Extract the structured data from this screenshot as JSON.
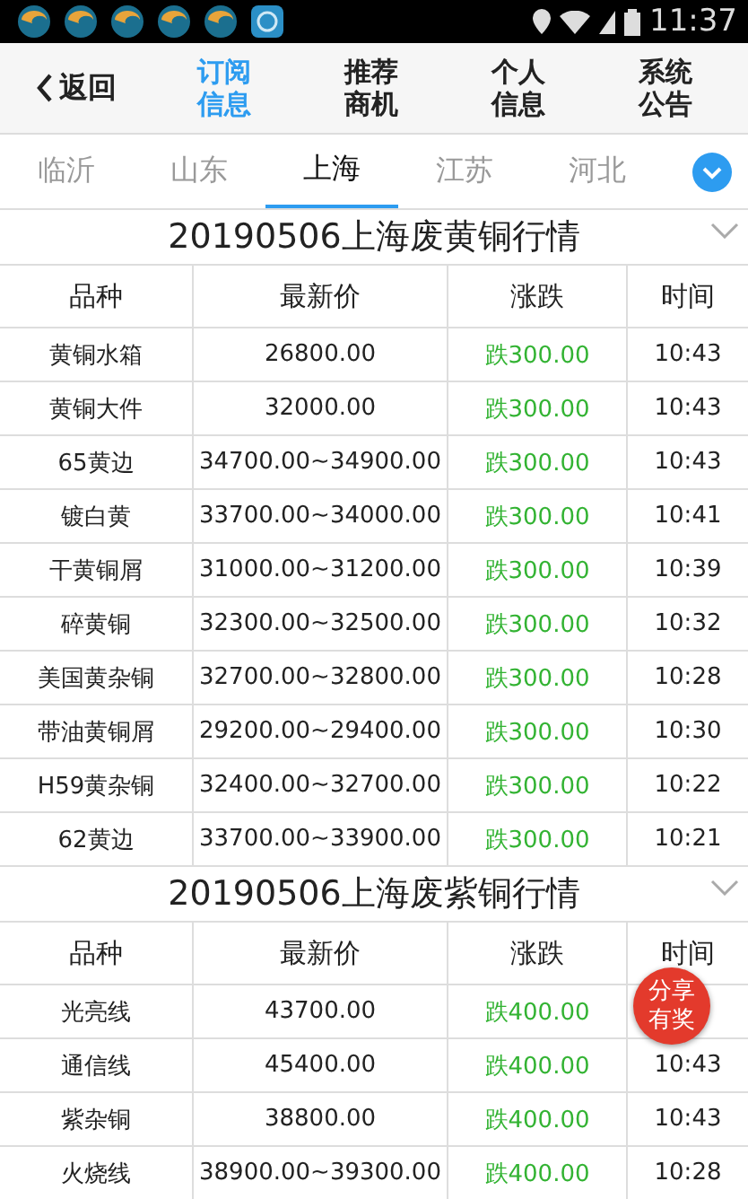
{
  "status_bar": {
    "time": "11:37"
  },
  "nav": {
    "back": "返回",
    "tabs": [
      {
        "label": "订阅信息",
        "selected": true
      },
      {
        "label": "推荐商机",
        "selected": false
      },
      {
        "label": "个人信息",
        "selected": false
      },
      {
        "label": "系统公告",
        "selected": false
      }
    ]
  },
  "regions": [
    {
      "label": "临沂",
      "selected": false
    },
    {
      "label": "山东",
      "selected": false
    },
    {
      "label": "上海",
      "selected": true
    },
    {
      "label": "江苏",
      "selected": false
    },
    {
      "label": "河北",
      "selected": false
    }
  ],
  "sections": [
    {
      "title": "20190506上海废黄铜行情",
      "columns": [
        "品种",
        "最新价",
        "涨跌",
        "时间"
      ],
      "rows": [
        {
          "name": "黄铜水箱",
          "price": "26800.00",
          "change": "跌300.00",
          "falling": true,
          "time": "10:43"
        },
        {
          "name": "黄铜大件",
          "price": "32000.00",
          "change": "跌300.00",
          "falling": true,
          "time": "10:43"
        },
        {
          "name": "65黄边",
          "price": "34700.00~34900.00",
          "change": "跌300.00",
          "falling": true,
          "time": "10:43"
        },
        {
          "name": "镀白黄",
          "price": "33700.00~34000.00",
          "change": "跌300.00",
          "falling": true,
          "time": "10:41"
        },
        {
          "name": "干黄铜屑",
          "price": "31000.00~31200.00",
          "change": "跌300.00",
          "falling": true,
          "time": "10:39"
        },
        {
          "name": "碎黄铜",
          "price": "32300.00~32500.00",
          "change": "跌300.00",
          "falling": true,
          "time": "10:32"
        },
        {
          "name": "美国黄杂铜",
          "price": "32700.00~32800.00",
          "change": "跌300.00",
          "falling": true,
          "time": "10:28"
        },
        {
          "name": "带油黄铜屑",
          "price": "29200.00~29400.00",
          "change": "跌300.00",
          "falling": true,
          "time": "10:30"
        },
        {
          "name": "H59黄杂铜",
          "price": "32400.00~32700.00",
          "change": "跌300.00",
          "falling": true,
          "time": "10:22"
        },
        {
          "name": "62黄边",
          "price": "33700.00~33900.00",
          "change": "跌300.00",
          "falling": true,
          "time": "10:21"
        }
      ]
    },
    {
      "title": "20190506上海废紫铜行情",
      "columns": [
        "品种",
        "最新价",
        "涨跌",
        "时间"
      ],
      "rows": [
        {
          "name": "光亮线",
          "price": "43700.00",
          "change": "跌400.00",
          "falling": true
        },
        {
          "name": "通信线",
          "price": "45400.00",
          "change": "跌400.00",
          "falling": true,
          "time": "10:43"
        },
        {
          "name": "紫杂铜",
          "price": "38800.00",
          "change": "跌400.00",
          "falling": true,
          "time": "10:43"
        },
        {
          "name": "火烧线",
          "price": "38900.00~39300.00",
          "change": "跌400.00",
          "falling": true,
          "time": "10:28"
        }
      ]
    }
  ],
  "share_badge": "分享有奖"
}
